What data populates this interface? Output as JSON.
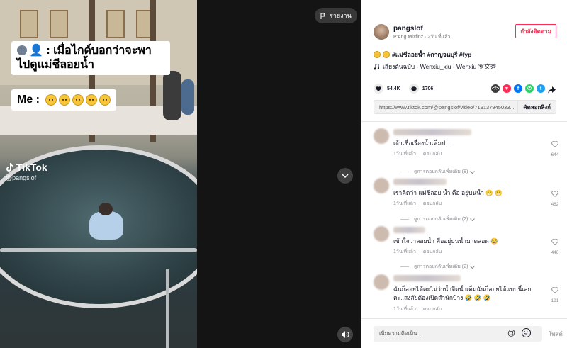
{
  "video": {
    "caption_line1": "เมื่อไกด์บอกว่าจะพาไปดูแม่ชีลอยน้ำ",
    "caption_prefix": "👤 :",
    "caption_me": "Me :",
    "caption_me_emoji_count": 5,
    "watermark": "TikTok",
    "watermark_handle": "@pangslof",
    "report_label": "รายงาน"
  },
  "author": {
    "username": "pangslof",
    "subtitle": "P'Ang Mizfinz · 2วัน ที่แล้ว",
    "follow_label": "กำลังติดตาม"
  },
  "post": {
    "hashtags": "#แม่ชีลอยน้ำ #กาญจนบุรี #fyp",
    "music": "เสียงต้นฉบับ - Wenxiu_xiu - Wenxiu 罗文秀"
  },
  "stats": {
    "likes": "54.4K",
    "comments": "1706"
  },
  "share": {
    "link": "https://www.tiktok.com/@pangslof/video/719137945033...",
    "copy_label": "คัดลอกลิงก์"
  },
  "comments": [
    {
      "text": "เจ้าเชื่อเรื่องน้ำเค็มป่...",
      "time": "1วัน ที่แล้ว",
      "reply_label": "ตอบกลับ",
      "likes": "644",
      "more_replies": "ดูการตอบกลับเพิ่มเติม (8)"
    },
    {
      "text": "เราคิดว่า แม่ชีลอย น้ำ คือ อยู่บนน้ำ 😁 😁",
      "time": "1วัน ที่แล้ว",
      "reply_label": "ตอบกลับ",
      "likes": "482",
      "more_replies": "ดูการตอบกลับเพิ่มเติม (2)"
    },
    {
      "text": "เข้าใจว่าลอยน้ำ คืออยู่บนน้ำมาตลอด 😂",
      "time": "1วัน ที่แล้ว",
      "reply_label": "ตอบกลับ",
      "likes": "446",
      "more_replies": "ดูการตอบกลับเพิ่มเติม (2)"
    },
    {
      "text": "ฉันก็ลอยได้คะไม่ว่าน้ำจืดน้ำเค็มฉันก็ลอยได้แบบนี้เลยคะ..สงสัยต้องเปิดสำนักบ้าง 🤣 🤣 🤣",
      "time": "1วัน ที่แล้ว",
      "reply_label": "ตอบกลับ",
      "likes": "191"
    }
  ],
  "comment_bar": {
    "placeholder": "เพิ่มความคิดเห็น...",
    "post_label": "โพสต์"
  },
  "colors": {
    "accent": "#fe2c55",
    "panel_bg": "#ffffff",
    "text": "#161823",
    "muted": "#8a8b91"
  }
}
